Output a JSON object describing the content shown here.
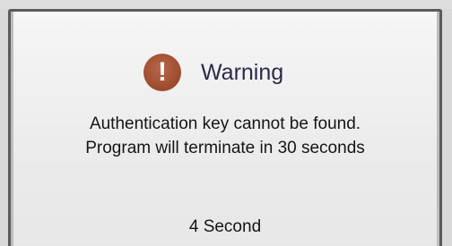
{
  "dialog": {
    "title": "Warning",
    "icon": "exclamation-icon",
    "icon_glyph": "!",
    "message_line1": "Authentication key cannot be found.",
    "message_line2": "Program will terminate in 30 seconds",
    "countdown": "4 Second"
  },
  "colors": {
    "icon_bg": "#a4533a",
    "dialog_border": "#5b5b5b",
    "dialog_bg": "#efefef"
  }
}
